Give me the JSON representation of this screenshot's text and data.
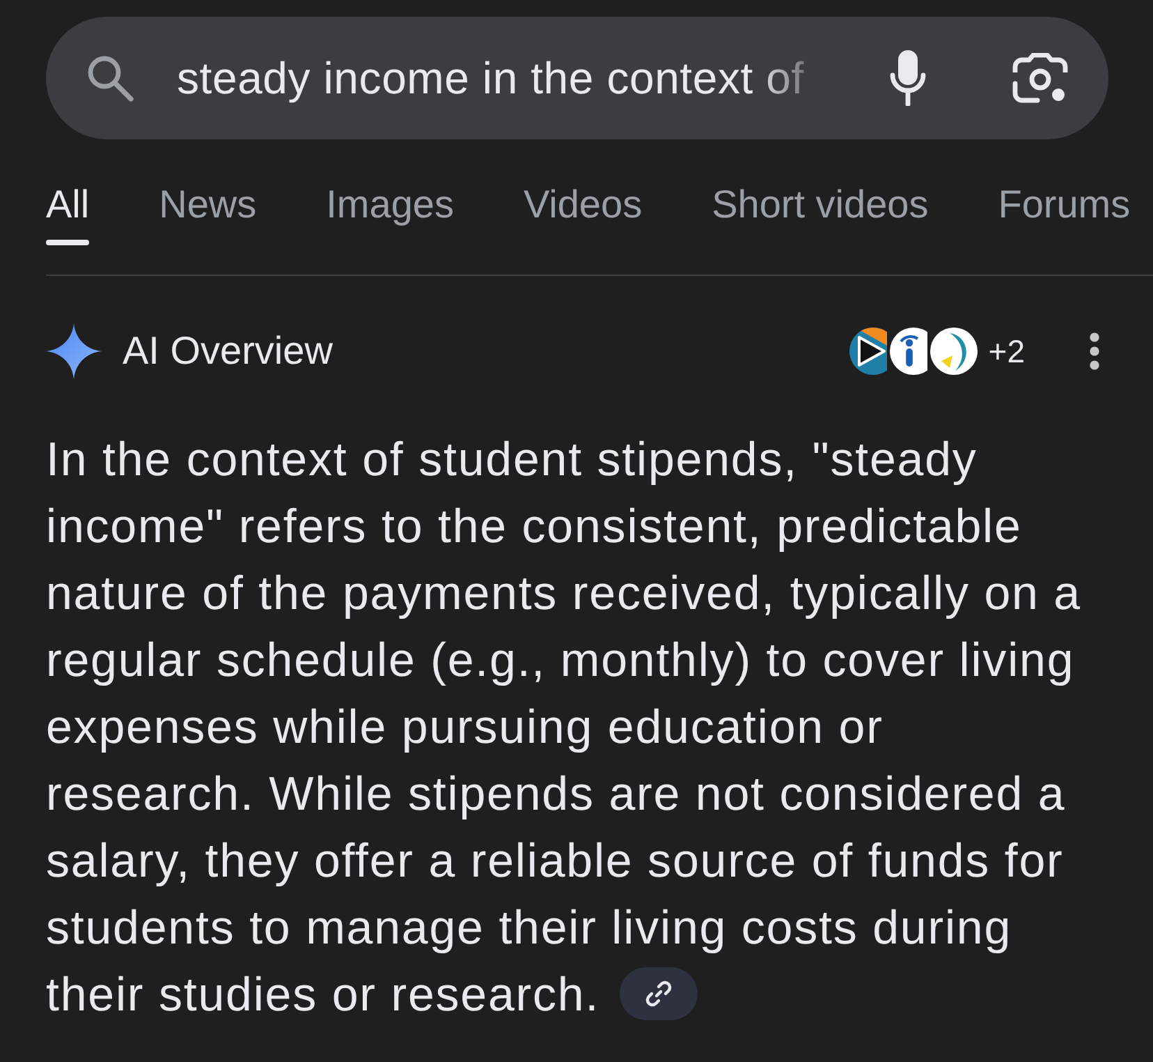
{
  "search": {
    "value": "steady income in the context of"
  },
  "tabs": [
    {
      "label": "All",
      "selected": true
    },
    {
      "label": "News",
      "selected": false
    },
    {
      "label": "Images",
      "selected": false
    },
    {
      "label": "Videos",
      "selected": false
    },
    {
      "label": "Short videos",
      "selected": false
    },
    {
      "label": "Forums",
      "selected": false
    }
  ],
  "ai_overview": {
    "title": "AI Overview",
    "more_sources": "+2",
    "summary": "In the context of student stipends, \"steady income\" refers to the consistent, predictable nature of the payments received, typically on a regular schedule (e.g., monthly) to cover living expenses while pursuing education or research. While stipends are not considered a salary, they offer a reliable source of funds for students to manage their living costs during their studies or research."
  }
}
